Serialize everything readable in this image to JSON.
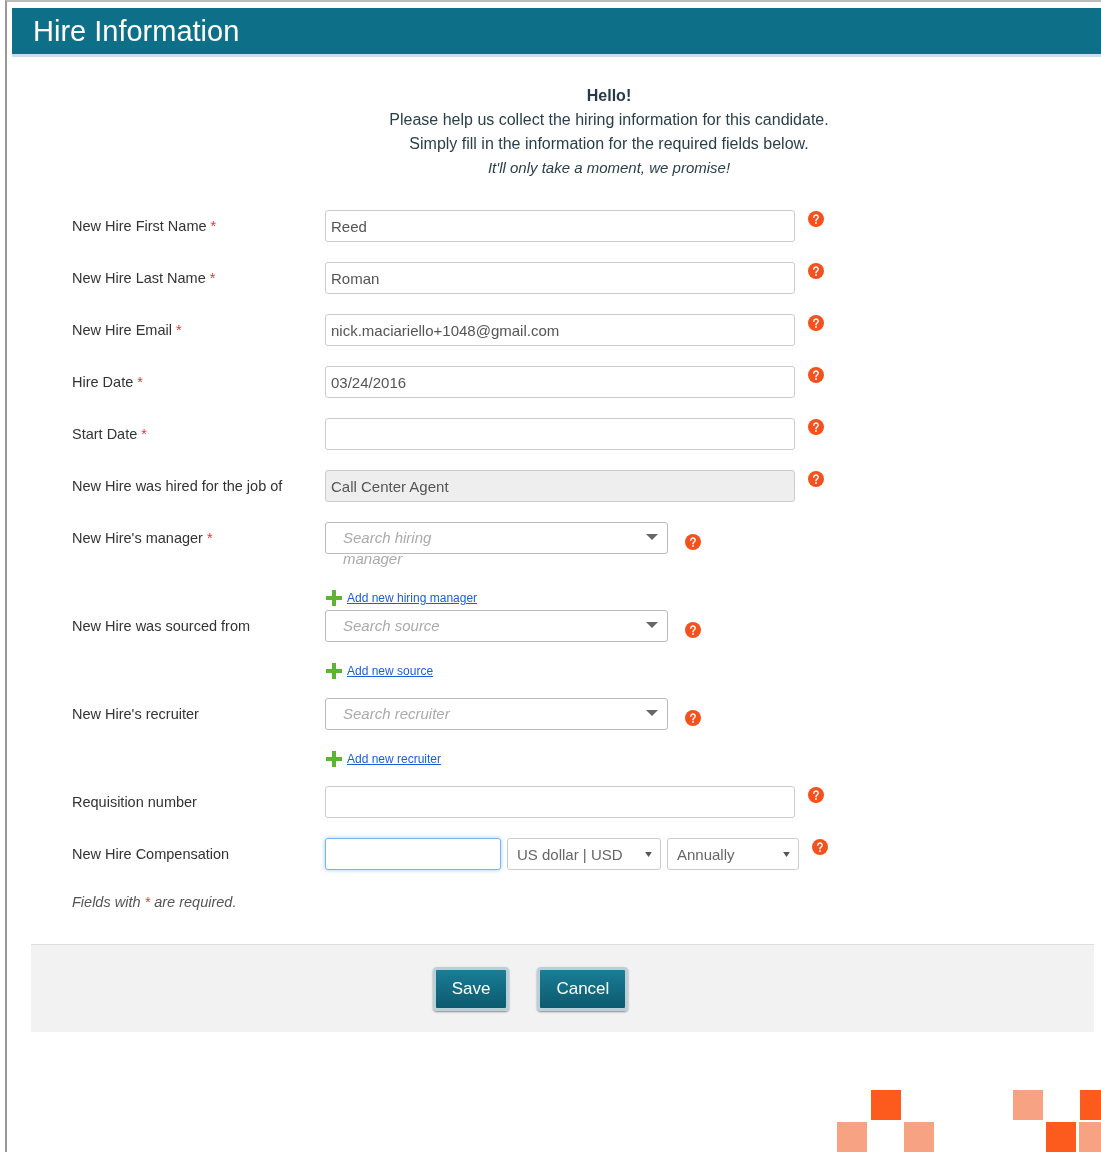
{
  "header": {
    "title": "Hire Information"
  },
  "intro": {
    "greeting": "Hello!",
    "lines": [
      "Please help us collect the hiring information for this candidate.",
      "Simply fill in the information for the required fields below."
    ],
    "note": "It'll only take a moment, we promise!"
  },
  "required_mark": "*",
  "fields": [
    {
      "kind": "text",
      "label": "New Hire First Name",
      "required": true,
      "value": "Reed"
    },
    {
      "kind": "text",
      "label": "New Hire Last Name",
      "required": true,
      "value": "Roman"
    },
    {
      "kind": "text",
      "label": "New Hire Email",
      "required": true,
      "value": "nick.maciariello+1048@gmail.com"
    },
    {
      "kind": "text",
      "label": "Hire Date",
      "required": true,
      "value": "03/24/2016"
    },
    {
      "kind": "text",
      "label": "Start Date",
      "required": true
    },
    {
      "kind": "readonly",
      "label": "New Hire was hired for the job of",
      "required": false,
      "value": "Call Center Agent"
    },
    {
      "kind": "search",
      "label": "New Hire's manager",
      "required": true,
      "placeholder": "Search hiring manager",
      "add_link": "Add new hiring manager"
    },
    {
      "kind": "search",
      "label": "New Hire was sourced from",
      "required": false,
      "placeholder": "Search source",
      "add_link": "Add new source"
    },
    {
      "kind": "search",
      "label": "New Hire's recruiter",
      "required": false,
      "placeholder": "Search recruiter",
      "add_link": "Add new recruiter"
    },
    {
      "kind": "text",
      "label": "Requisition number",
      "required": false
    },
    {
      "kind": "compensation",
      "label": "New Hire Compensation",
      "required": false,
      "focused": true,
      "currency": "US dollar | USD",
      "period": "Annually"
    }
  ],
  "footnote": {
    "before": "Fields with ",
    "after": " are required."
  },
  "buttons": [
    "Save",
    "Cancel"
  ]
}
